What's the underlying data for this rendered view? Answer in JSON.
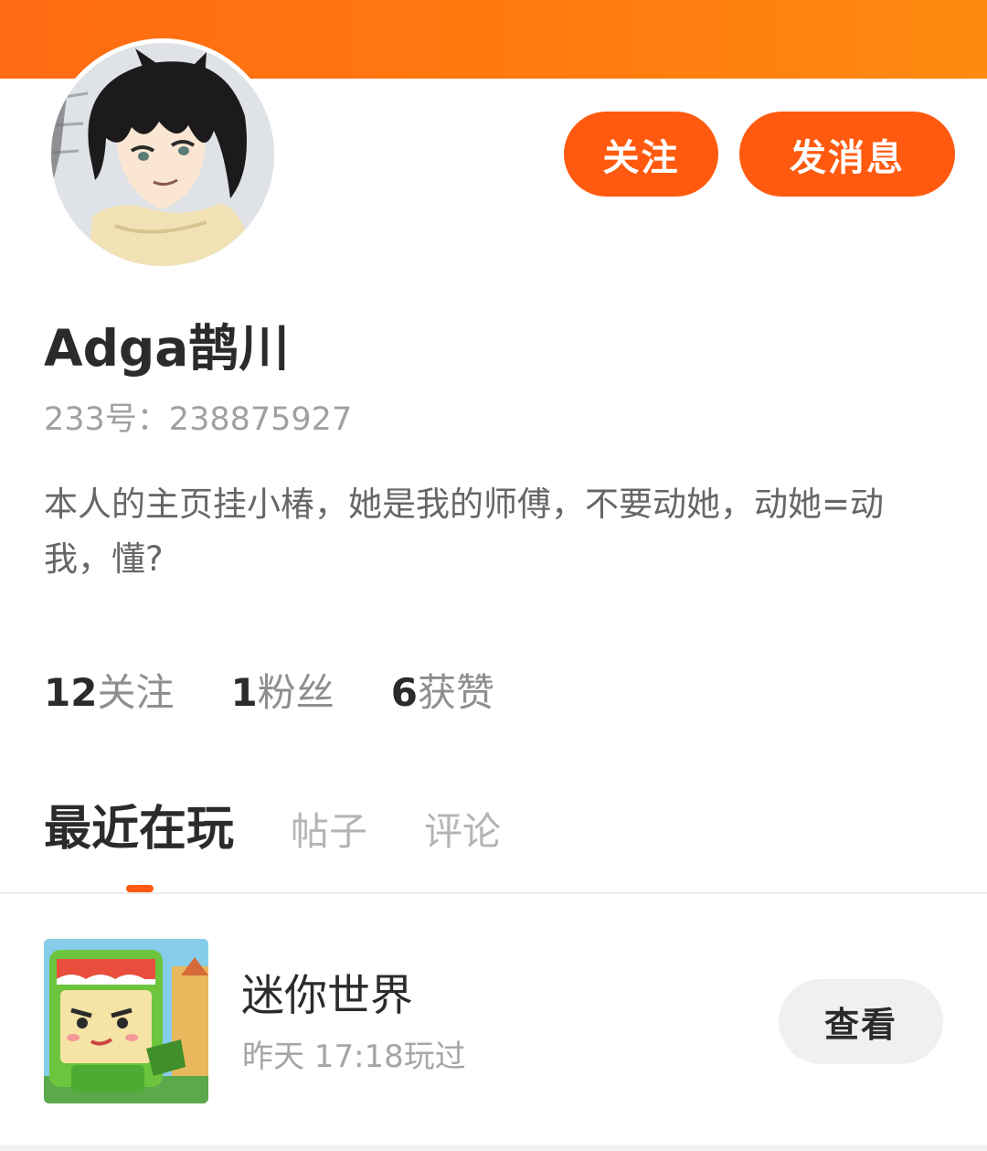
{
  "profile": {
    "username": "Adga鹊川",
    "uid_text": "233号：238875927",
    "bio": "本人的主页挂小椿，她是我的师傅，不要动她，动她=动我，懂?",
    "avatar_icon": "anime-boy-avatar"
  },
  "actions": {
    "follow_label": "关注",
    "message_label": "发消息"
  },
  "stats": [
    {
      "value": "12",
      "label": "关注"
    },
    {
      "value": "1",
      "label": "粉丝"
    },
    {
      "value": "6",
      "label": "获赞"
    }
  ],
  "tabs": [
    {
      "label": "最近在玩",
      "active": true
    },
    {
      "label": "帖子",
      "active": false
    },
    {
      "label": "评论",
      "active": false
    }
  ],
  "recent_games": [
    {
      "name": "迷你世界",
      "played_time": "昨天 17:18玩过",
      "action_label": "查看",
      "icon": "mini-world-game-icon"
    }
  ],
  "colors": {
    "accent": "#ff5a0f",
    "header": "#ff7c10"
  }
}
